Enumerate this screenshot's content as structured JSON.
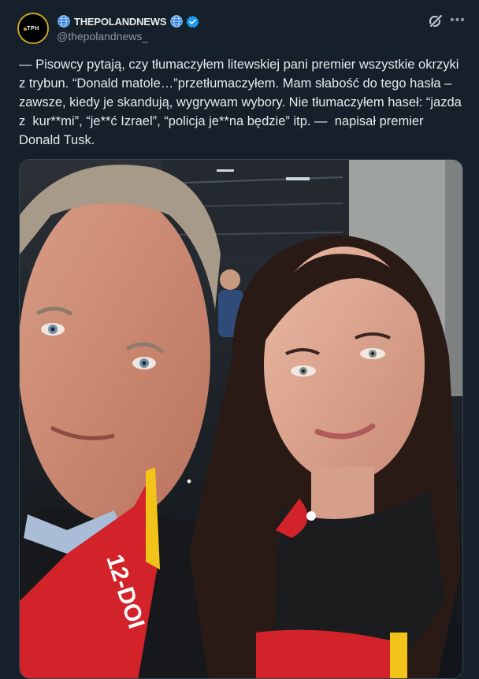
{
  "account": {
    "display_name": "THEPOLANDNEWS",
    "handle": "@thepolandnews_",
    "avatar_text": "TPH"
  },
  "post": {
    "text": "— Pisowcy pytają, czy tłumaczyłem litewskiej pani premier wszystkie okrzyki z trybun. “Donald matole…”przetłumaczyłem. Mam słabość do tego hasła – zawsze, kiedy je skandują, wygrywam wybory. Nie tłumaczyłem haseł: “jazda z  kur**mi”, “je**ć Izrael”, “policja je**na będzie” itp. —  napisał premier Donald Tusk.",
    "image_scarf_text": "12-DOI"
  },
  "icons": {
    "globe": "globe-icon",
    "verified": "verified-badge-icon",
    "grok": "grok-icon",
    "more": "more-icon"
  },
  "colors": {
    "background": "#15202b",
    "verified": "#1d9bf0",
    "muted_text": "#8b98a5",
    "scarf_red": "#d2232a"
  }
}
